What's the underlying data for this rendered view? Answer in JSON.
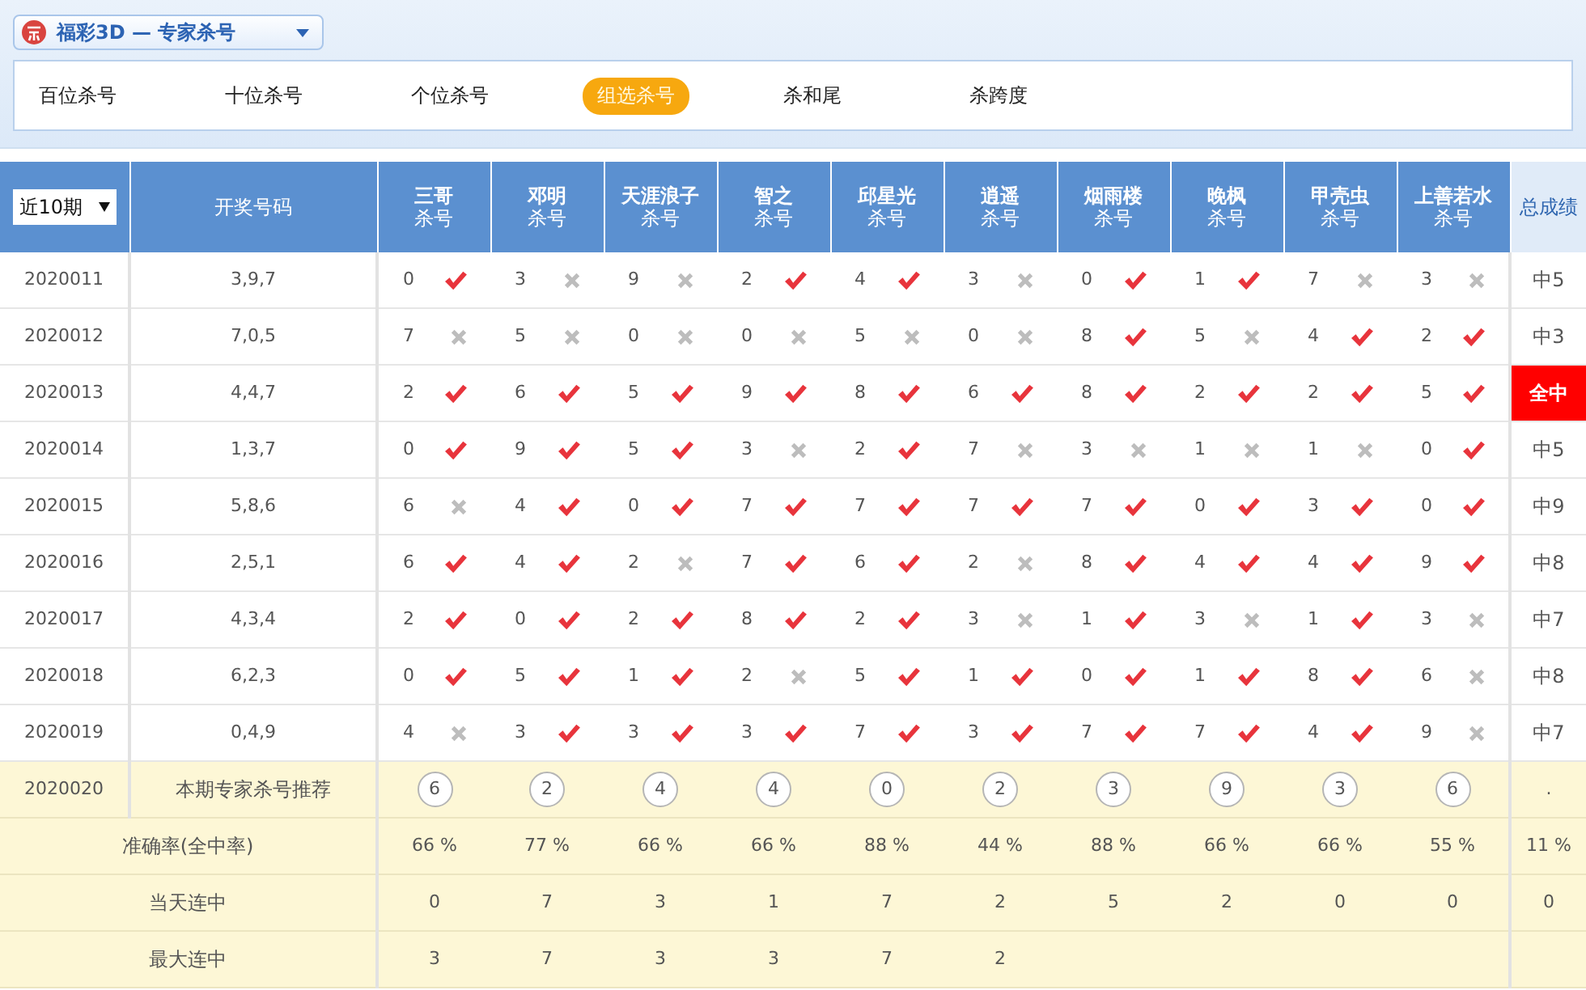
{
  "header": {
    "title": "福彩3D — 专家杀号"
  },
  "tabs": [
    {
      "label": "百位杀号",
      "selected": false
    },
    {
      "label": "十位杀号",
      "selected": false
    },
    {
      "label": "个位杀号",
      "selected": false
    },
    {
      "label": "组选杀号",
      "selected": true
    },
    {
      "label": "杀和尾",
      "selected": false
    },
    {
      "label": "杀跨度",
      "selected": false
    }
  ],
  "table": {
    "period_select": "近10期",
    "draw_header": "开奖号码",
    "total_header": "总成绩",
    "experts": [
      {
        "name": "三哥",
        "sub": "杀号"
      },
      {
        "name": "邓明",
        "sub": "杀号"
      },
      {
        "name": "天涯浪子",
        "sub": "杀号"
      },
      {
        "name": "智之",
        "sub": "杀号"
      },
      {
        "name": "邱星光",
        "sub": "杀号"
      },
      {
        "name": "逍遥",
        "sub": "杀号"
      },
      {
        "name": "烟雨楼",
        "sub": "杀号"
      },
      {
        "name": "晚枫",
        "sub": "杀号"
      },
      {
        "name": "甲壳虫",
        "sub": "杀号"
      },
      {
        "name": "上善若水",
        "sub": "杀号"
      }
    ],
    "rows": [
      {
        "period": "2020011",
        "draw": "3,9,7",
        "cells": [
          {
            "number": "0",
            "hit": true
          },
          {
            "number": "3",
            "hit": false
          },
          {
            "number": "9",
            "hit": false
          },
          {
            "number": "2",
            "hit": true
          },
          {
            "number": "4",
            "hit": true
          },
          {
            "number": "3",
            "hit": false
          },
          {
            "number": "0",
            "hit": true
          },
          {
            "number": "1",
            "hit": true
          },
          {
            "number": "7",
            "hit": false
          },
          {
            "number": "3",
            "hit": false
          }
        ],
        "total": "中5",
        "highlight": false
      },
      {
        "period": "2020012",
        "draw": "7,0,5",
        "cells": [
          {
            "number": "7",
            "hit": false
          },
          {
            "number": "5",
            "hit": false
          },
          {
            "number": "0",
            "hit": false
          },
          {
            "number": "0",
            "hit": false
          },
          {
            "number": "5",
            "hit": false
          },
          {
            "number": "0",
            "hit": false
          },
          {
            "number": "8",
            "hit": true
          },
          {
            "number": "5",
            "hit": false
          },
          {
            "number": "4",
            "hit": true
          },
          {
            "number": "2",
            "hit": true
          }
        ],
        "total": "中3",
        "highlight": false
      },
      {
        "period": "2020013",
        "draw": "4,4,7",
        "cells": [
          {
            "number": "2",
            "hit": true
          },
          {
            "number": "6",
            "hit": true
          },
          {
            "number": "5",
            "hit": true
          },
          {
            "number": "9",
            "hit": true
          },
          {
            "number": "8",
            "hit": true
          },
          {
            "number": "6",
            "hit": true
          },
          {
            "number": "8",
            "hit": true
          },
          {
            "number": "2",
            "hit": true
          },
          {
            "number": "2",
            "hit": true
          },
          {
            "number": "5",
            "hit": true
          }
        ],
        "total": "全中",
        "highlight": true
      },
      {
        "period": "2020014",
        "draw": "1,3,7",
        "cells": [
          {
            "number": "0",
            "hit": true
          },
          {
            "number": "9",
            "hit": true
          },
          {
            "number": "5",
            "hit": true
          },
          {
            "number": "3",
            "hit": false
          },
          {
            "number": "2",
            "hit": true
          },
          {
            "number": "7",
            "hit": false
          },
          {
            "number": "3",
            "hit": false
          },
          {
            "number": "1",
            "hit": false
          },
          {
            "number": "1",
            "hit": false
          },
          {
            "number": "0",
            "hit": true
          }
        ],
        "total": "中5",
        "highlight": false
      },
      {
        "period": "2020015",
        "draw": "5,8,6",
        "cells": [
          {
            "number": "6",
            "hit": false
          },
          {
            "number": "4",
            "hit": true
          },
          {
            "number": "0",
            "hit": true
          },
          {
            "number": "7",
            "hit": true
          },
          {
            "number": "7",
            "hit": true
          },
          {
            "number": "7",
            "hit": true
          },
          {
            "number": "7",
            "hit": true
          },
          {
            "number": "0",
            "hit": true
          },
          {
            "number": "3",
            "hit": true
          },
          {
            "number": "0",
            "hit": true
          }
        ],
        "total": "中9",
        "highlight": false
      },
      {
        "period": "2020016",
        "draw": "2,5,1",
        "cells": [
          {
            "number": "6",
            "hit": true
          },
          {
            "number": "4",
            "hit": true
          },
          {
            "number": "2",
            "hit": false
          },
          {
            "number": "7",
            "hit": true
          },
          {
            "number": "6",
            "hit": true
          },
          {
            "number": "2",
            "hit": false
          },
          {
            "number": "8",
            "hit": true
          },
          {
            "number": "4",
            "hit": true
          },
          {
            "number": "4",
            "hit": true
          },
          {
            "number": "9",
            "hit": true
          }
        ],
        "total": "中8",
        "highlight": false
      },
      {
        "period": "2020017",
        "draw": "4,3,4",
        "cells": [
          {
            "number": "2",
            "hit": true
          },
          {
            "number": "0",
            "hit": true
          },
          {
            "number": "2",
            "hit": true
          },
          {
            "number": "8",
            "hit": true
          },
          {
            "number": "2",
            "hit": true
          },
          {
            "number": "3",
            "hit": false
          },
          {
            "number": "1",
            "hit": true
          },
          {
            "number": "3",
            "hit": false
          },
          {
            "number": "1",
            "hit": true
          },
          {
            "number": "3",
            "hit": false
          }
        ],
        "total": "中7",
        "highlight": false
      },
      {
        "period": "2020018",
        "draw": "6,2,3",
        "cells": [
          {
            "number": "0",
            "hit": true
          },
          {
            "number": "5",
            "hit": true
          },
          {
            "number": "1",
            "hit": true
          },
          {
            "number": "2",
            "hit": false
          },
          {
            "number": "5",
            "hit": true
          },
          {
            "number": "1",
            "hit": true
          },
          {
            "number": "0",
            "hit": true
          },
          {
            "number": "1",
            "hit": true
          },
          {
            "number": "8",
            "hit": true
          },
          {
            "number": "6",
            "hit": false
          }
        ],
        "total": "中8",
        "highlight": false
      },
      {
        "period": "2020019",
        "draw": "0,4,9",
        "cells": [
          {
            "number": "4",
            "hit": false
          },
          {
            "number": "3",
            "hit": true
          },
          {
            "number": "3",
            "hit": true
          },
          {
            "number": "3",
            "hit": true
          },
          {
            "number": "7",
            "hit": true
          },
          {
            "number": "3",
            "hit": true
          },
          {
            "number": "7",
            "hit": true
          },
          {
            "number": "7",
            "hit": true
          },
          {
            "number": "4",
            "hit": true
          },
          {
            "number": "9",
            "hit": false
          }
        ],
        "total": "中7",
        "highlight": false
      }
    ],
    "recommend": {
      "period": "2020020",
      "label": "本期专家杀号推荐",
      "numbers": [
        "6",
        "2",
        "4",
        "4",
        "0",
        "2",
        "3",
        "9",
        "3",
        "6"
      ],
      "total": "."
    },
    "accuracy": {
      "label": "准确率(全中率)",
      "values": [
        "66 %",
        "77 %",
        "66 %",
        "66 %",
        "88 %",
        "44 %",
        "88 %",
        "66 %",
        "66 %",
        "55 %"
      ],
      "total": "11 %"
    },
    "today_streak": {
      "label": "当天连中",
      "values": [
        "0",
        "7",
        "3",
        "1",
        "7",
        "2",
        "5",
        "2",
        "0",
        "0"
      ],
      "total": "0"
    },
    "max_streak": {
      "label": "最大连中",
      "values": [
        "3",
        "7",
        "3",
        "3",
        "7",
        "2"
      ]
    }
  }
}
